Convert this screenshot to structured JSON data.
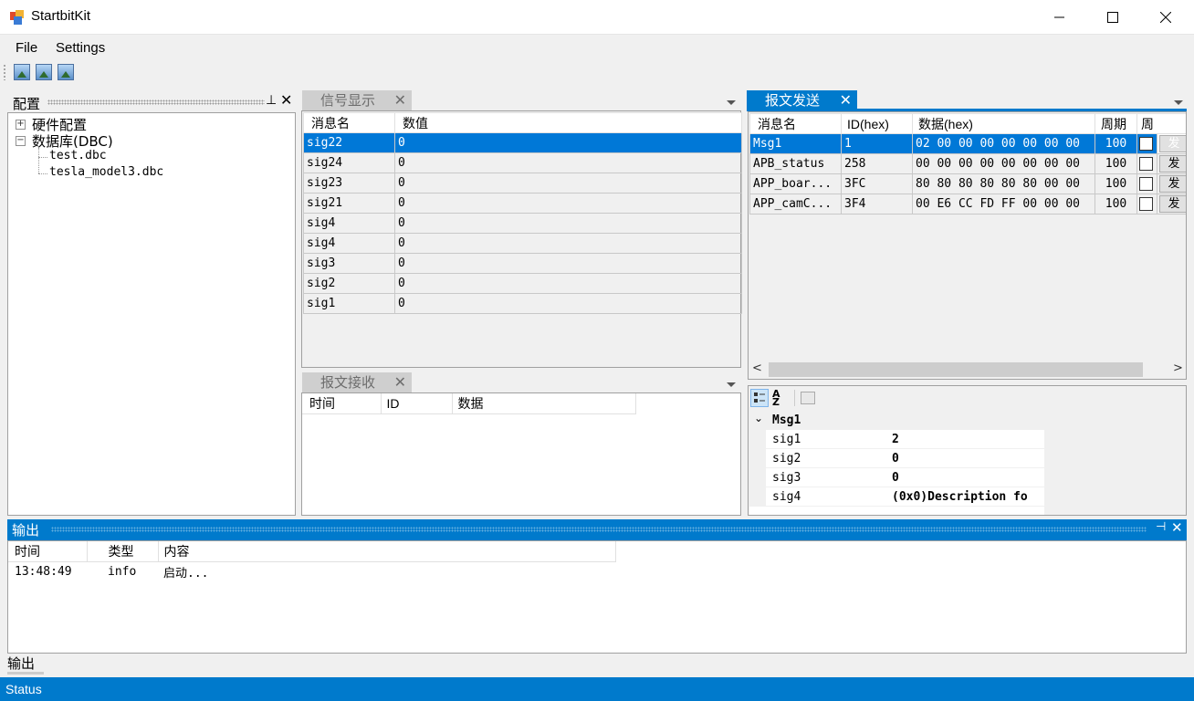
{
  "window": {
    "title": "StartbitKit",
    "minimize_icon": "minimize-icon",
    "maximize_icon": "maximize-icon",
    "close_icon": "close-icon"
  },
  "menu": {
    "file": "File",
    "settings": "Settings"
  },
  "toolbar": {
    "buttons": [
      "image-icon",
      "image-icon",
      "image-icon"
    ]
  },
  "config_panel": {
    "title": "配置",
    "tree": {
      "hardware": "硬件配置",
      "database": "数据库(DBC)",
      "files": [
        "test.dbc",
        "tesla_model3.dbc"
      ]
    }
  },
  "signal_panel": {
    "tab": "信号显示",
    "columns": [
      "消息名",
      "数值"
    ],
    "rows": [
      {
        "name": "sig22",
        "value": "0"
      },
      {
        "name": "sig24",
        "value": "0"
      },
      {
        "name": "sig23",
        "value": "0"
      },
      {
        "name": "sig21",
        "value": "0"
      },
      {
        "name": "sig4",
        "value": "0"
      },
      {
        "name": "sig4",
        "value": "0"
      },
      {
        "name": "sig3",
        "value": "0"
      },
      {
        "name": "sig2",
        "value": "0"
      },
      {
        "name": "sig1",
        "value": "0"
      }
    ]
  },
  "receive_panel": {
    "tab": "报文接收",
    "columns": [
      "时间",
      "ID",
      "数据"
    ]
  },
  "send_panel": {
    "tab": "报文发送",
    "columns": [
      "消息名",
      "ID(hex)",
      "数据(hex)",
      "周期",
      "周"
    ],
    "rows": [
      {
        "name": "Msg1",
        "id": "1",
        "data": "02 00 00 00 00 00 00 00",
        "period": "100",
        "button": "发"
      },
      {
        "name": "APB_status",
        "id": "258",
        "data": "00 00 00 00 00 00 00 00",
        "period": "100",
        "button": "发"
      },
      {
        "name": "APP_boar...",
        "id": "3FC",
        "data": "80 80 80 80 80 80 00 00",
        "period": "100",
        "button": "发"
      },
      {
        "name": "APP_camC...",
        "id": "3F4",
        "data": "00 E6 CC FD FF 00 00 00",
        "period": "100",
        "button": "发"
      }
    ]
  },
  "property_grid": {
    "category": "Msg1",
    "rows": [
      {
        "name": "sig1",
        "value": "2"
      },
      {
        "name": "sig2",
        "value": "0"
      },
      {
        "name": "sig3",
        "value": "0"
      },
      {
        "name": "sig4",
        "value": "(0x0)Description fo"
      }
    ]
  },
  "output_panel": {
    "title": "输出",
    "columns": [
      "时间",
      "类型",
      "内容"
    ],
    "rows": [
      {
        "time": "13:48:49",
        "type": "info",
        "content": "启动..."
      }
    ],
    "bottom_tab": "输出"
  },
  "status": {
    "text": "Status"
  },
  "colors": {
    "accent": "#007acc",
    "selection": "#0078d7"
  }
}
